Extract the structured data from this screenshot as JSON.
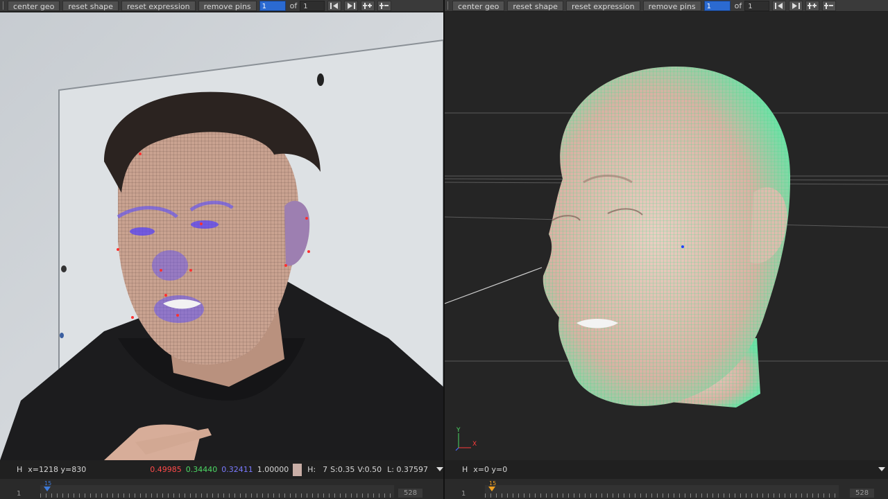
{
  "toolbar": {
    "buttons": [
      "center geo",
      "reset shape",
      "reset expression",
      "remove pins"
    ],
    "current_frame": "1",
    "of_label": "of",
    "total_frames": "1",
    "icons": [
      "keyframe-prev-icon",
      "keyframe-next-icon",
      "add-pin-icon",
      "remove-pin-icon"
    ]
  },
  "left_viewer": {
    "info": {
      "channel": "H",
      "coords": "x=1218 y=830",
      "r": "0.49985",
      "g": "0.34440",
      "b": "0.32411",
      "a": "1.00000",
      "swatch_color": "#c9aea6",
      "hsv_h_label": "H:",
      "hsv_h": "7",
      "hsv_s": "S:0.35",
      "hsv_v": "V:0.50",
      "luma": "L: 0.37597"
    },
    "timeline": {
      "start": "1",
      "end": "528",
      "marker": "15"
    }
  },
  "right_viewer": {
    "info": {
      "channel": "H",
      "coords": "x=0 y=0"
    },
    "timeline": {
      "start": "1",
      "end": "528",
      "marker": "15"
    },
    "axis": {
      "y": "Y",
      "x": "X"
    }
  },
  "colors": {
    "red": "#ff4a4a",
    "green": "#4cd964",
    "blue": "#6a6aff",
    "accent": "#2b6ad1",
    "wire": "#3de08a",
    "marker_left": "#3d7bdc",
    "marker_right": "#f0a020"
  }
}
